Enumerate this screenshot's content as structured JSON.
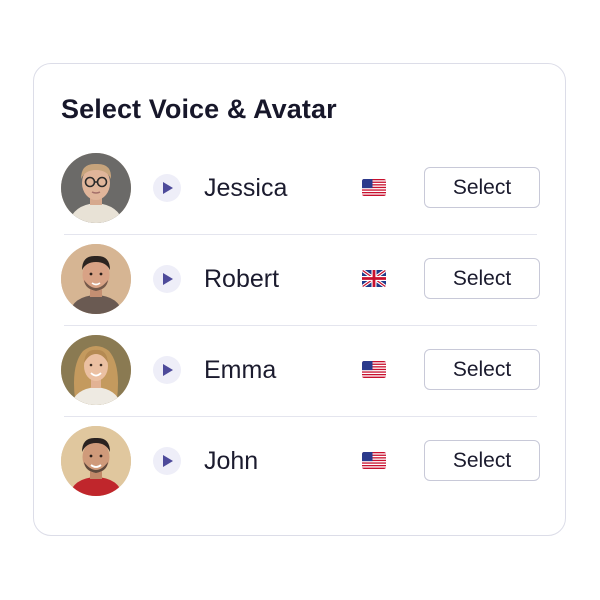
{
  "title": "Select Voice & Avatar",
  "rows": [
    {
      "name": "Jessica",
      "flag": "flag-us-icon",
      "button": "Select"
    },
    {
      "name": "Robert",
      "flag": "flag-uk-icon",
      "button": "Select"
    },
    {
      "name": "Emma",
      "flag": "flag-us-icon",
      "button": "Select"
    },
    {
      "name": "John",
      "flag": "flag-us-icon",
      "button": "Select"
    }
  ],
  "colors": {
    "accent": "#4d4a9a",
    "play_bg": "#eeeef8",
    "border": "#dcdde8",
    "text": "#1b1b2e"
  }
}
